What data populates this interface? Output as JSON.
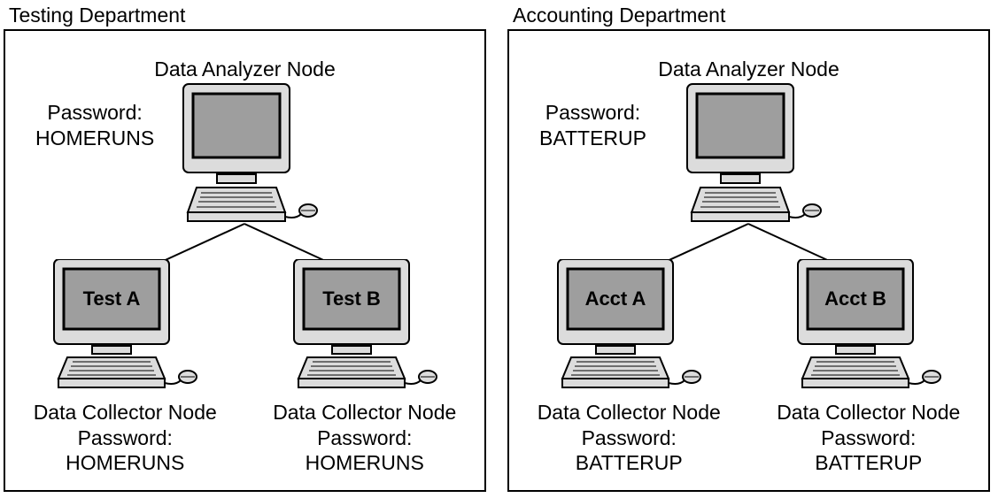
{
  "departments": [
    {
      "title": "Testing Department",
      "analyzer": {
        "title": "Data Analyzer Node",
        "password_label": "Password:",
        "password_value": "HOMERUNS"
      },
      "collectors": [
        {
          "screen_label": "Test A",
          "role": "Data Collector Node",
          "password_label": "Password:",
          "password_value": "HOMERUNS"
        },
        {
          "screen_label": "Test B",
          "role": "Data Collector Node",
          "password_label": "Password:",
          "password_value": "HOMERUNS"
        }
      ]
    },
    {
      "title": "Accounting Department",
      "analyzer": {
        "title": "Data Analyzer Node",
        "password_label": "Password:",
        "password_value": "BATTERUP"
      },
      "collectors": [
        {
          "screen_label": "Acct A",
          "role": "Data Collector Node",
          "password_label": "Password:",
          "password_value": "BATTERUP"
        },
        {
          "screen_label": "Acct B",
          "role": "Data Collector Node",
          "password_label": "Password:",
          "password_value": "BATTERUP"
        }
      ]
    }
  ]
}
